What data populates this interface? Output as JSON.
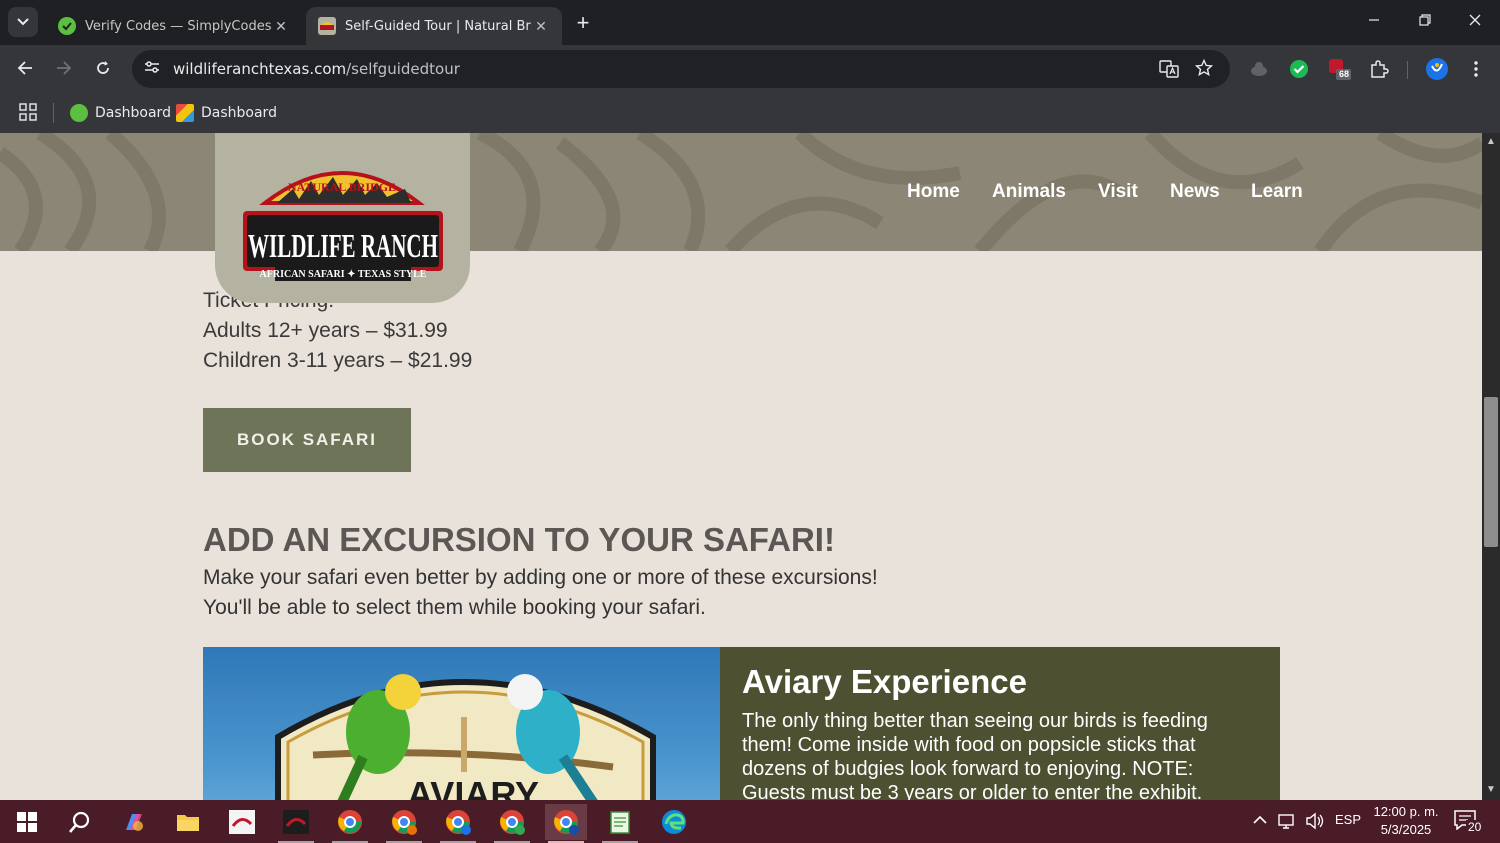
{
  "browser": {
    "tabs": [
      {
        "title": "Verify Codes — SimplyCodes",
        "active": false
      },
      {
        "title": "Self-Guided Tour | Natural Bridge Wildlife Ranch",
        "active": true
      }
    ],
    "url_host": "wildliferanchtexas.com",
    "url_path": "/selfguidedtour",
    "extension_badge": "68",
    "bookmarks": [
      {
        "label": "Dashboard"
      },
      {
        "label": "Dashboard"
      }
    ]
  },
  "site": {
    "logo": {
      "top_text": "NATURAL BRIDGE",
      "main_text": "WILDLIFE RANCH",
      "tagline": "AFRICAN SAFARI ✦ TEXAS STYLE"
    },
    "nav": [
      "Home",
      "Animals",
      "Visit",
      "News",
      "Learn"
    ]
  },
  "content": {
    "pricing_heading": "Ticket Pricing:",
    "price_adults": "Adults 12+ years – $31.99",
    "price_children": "Children 3-11 years – $21.99",
    "book_button": "BOOK SAFARI",
    "excursion_title": "ADD AN EXCURSION TO YOUR SAFARI!",
    "excursion_line1": "Make your safari even better by adding one or more of these excursions!",
    "excursion_line2": "You'll be able to select them while booking your safari.",
    "aviary": {
      "sign_text": "AVIARY",
      "heading": "Aviary Experience",
      "text": "The only thing better than seeing our birds is feeding them! Come inside with food on popsicle sticks that dozens of budgies look forward to enjoying. NOTE: Guests must be 3 years or older to enter the exhibit."
    }
  },
  "taskbar": {
    "language": "ESP",
    "time": "12:00 p. m.",
    "date": "5/3/2025",
    "notifications": "20"
  },
  "colors": {
    "header_bg": "#8c8676",
    "page_bg": "#e8e2da",
    "button_bg": "#6e7458",
    "card_bg": "#4d5131",
    "taskbar_bg": "#4a1c27"
  }
}
